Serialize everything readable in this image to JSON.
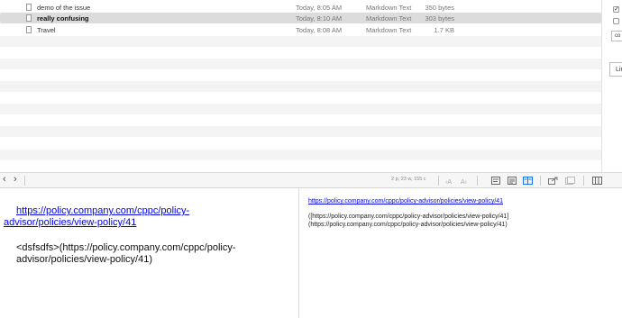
{
  "files": [
    {
      "name": "demo of the issue",
      "date": "Today, 8:05 AM",
      "kind": "Markdown Text",
      "size": "350 bytes"
    },
    {
      "name": "really confusing",
      "date": "Today, 8:10 AM",
      "kind": "Markdown Text",
      "size": "303 bytes",
      "selected": true
    },
    {
      "name": "Travel",
      "date": "Today, 8:08 AM",
      "kind": "Markdown Text",
      "size": "1.7 KB"
    }
  ],
  "right_panel": {
    "field_text": "co",
    "lin_text": "Lin",
    "checkbox1_checked": "✓"
  },
  "toolbar": {
    "back_glyph": "‹",
    "forward_glyph": "›",
    "stats": "2 p, 23 w, 155 c",
    "icons": [
      "font-smaller-icon",
      "font-larger-icon",
      "editor-only-icon",
      "preview-only-icon",
      "split-view-icon",
      "export-icon",
      "share-icon",
      "columns-icon"
    ]
  },
  "editor": {
    "link1_prefix": " ",
    "link1": "https://policy.company.com/cppc/policy-advisor/policies/view-policy/41",
    "p2_prefix": "<dsfsdfs>(",
    "link2": "https://policy.company.com/cppc/policy-advisor/policies/view-policy/41",
    "p2_suffix": ")"
  },
  "preview": {
    "link": "https://policy.company.com/cppc/policy-advisor/policies/view-policy/41",
    "text": "([https://policy.company.com/cppc/policy-advisor/policies/view-policy/41](https://policy.company.com/cppc/policy-advisor/policies/view-policy/41)"
  },
  "colors": {
    "selection": "#dcdcdc",
    "stripe": "#f4f4f5",
    "link": "#0000ee",
    "active_view": "#1a73e8"
  }
}
